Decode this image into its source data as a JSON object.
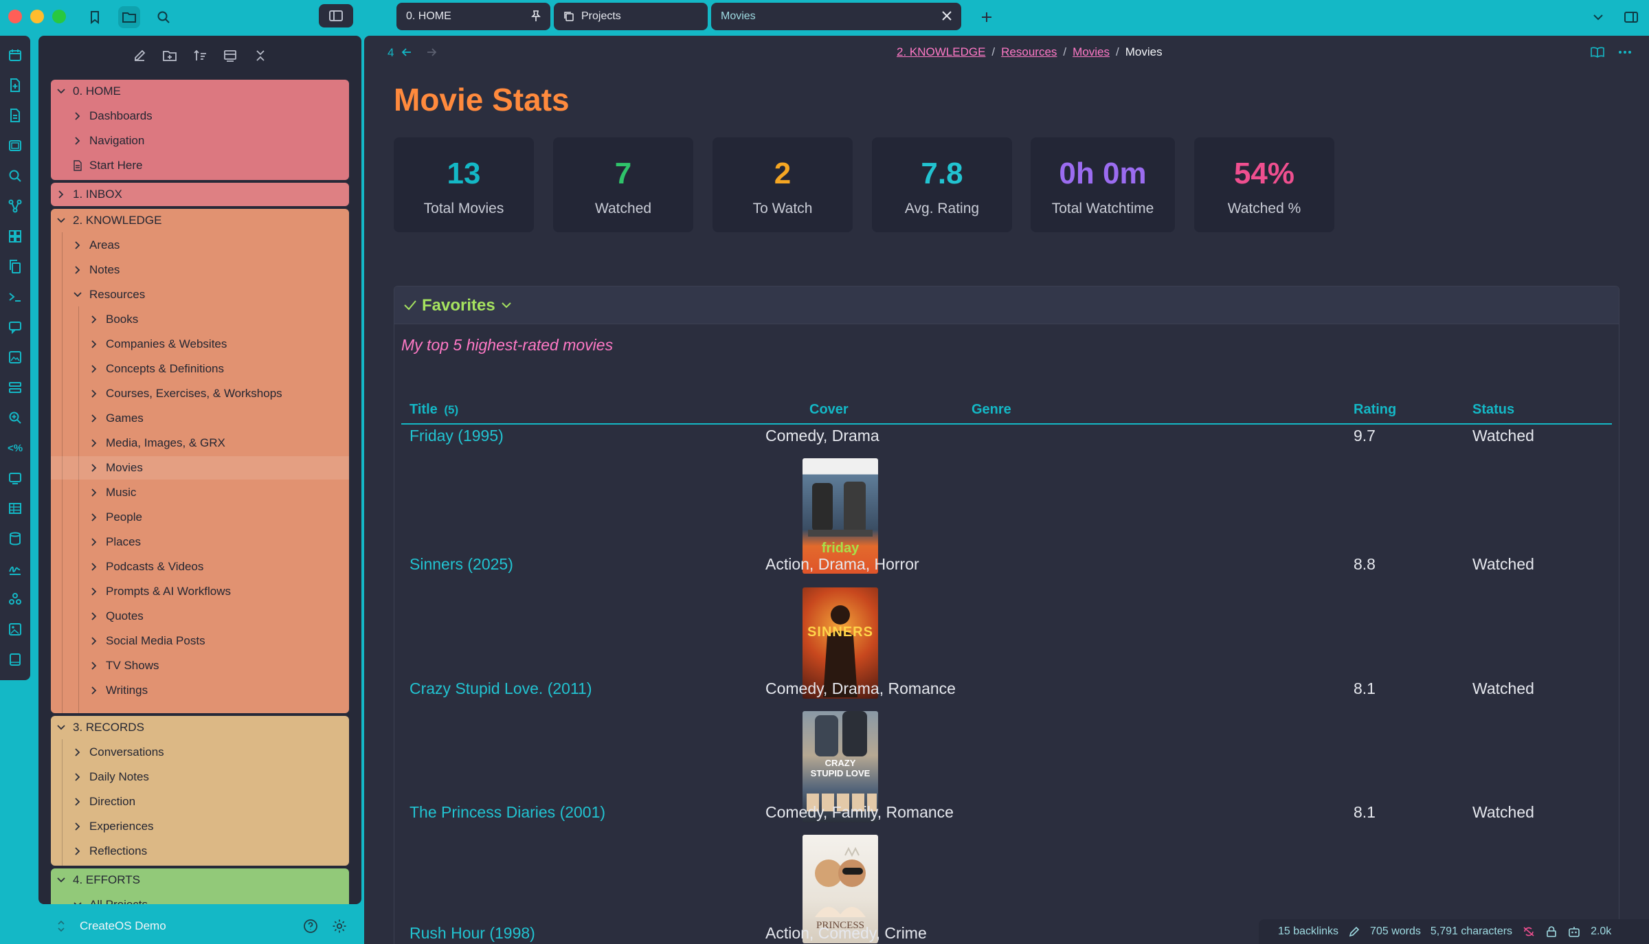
{
  "colors": {
    "accent": "#14b8c6",
    "home_group": "#dc7880",
    "inbox_group": "#de8083",
    "knowledge_group": "#e19271",
    "records_group": "#dcb885",
    "efforts_group": "#92c979",
    "title_orange": "#ff8a3d",
    "pink": "#ff79c6"
  },
  "tabs": [
    {
      "label": "0. HOME",
      "icon": "pin-icon"
    },
    {
      "label": "Projects",
      "icon": "copy-icon"
    },
    {
      "label": "Movies",
      "icon": "close-icon"
    }
  ],
  "nav": {
    "back_count": "4",
    "breadcrumb": [
      "2. KNOWLEDGE",
      "Resources",
      "Movies"
    ],
    "current": "Movies"
  },
  "tree": {
    "home": {
      "label": "0. HOME",
      "items": [
        "Dashboards",
        "Navigation"
      ],
      "file": "Start Here"
    },
    "inbox": {
      "label": "1. INBOX"
    },
    "knowledge": {
      "label": "2. KNOWLEDGE",
      "items": [
        "Areas",
        "Notes"
      ],
      "resources": "Resources",
      "resource_items": [
        "Books",
        "Companies & Websites",
        "Concepts & Definitions",
        "Courses, Exercises, & Workshops",
        "Games",
        "Media, Images, & GRX",
        "Movies",
        "Music",
        "People",
        "Places",
        "Podcasts & Videos",
        "Prompts & AI Workflows",
        "Quotes",
        "Social Media Posts",
        "TV Shows",
        "Writings"
      ]
    },
    "records": {
      "label": "3. RECORDS",
      "items": [
        "Conversations",
        "Daily Notes",
        "Direction",
        "Experiences",
        "Reflections"
      ]
    },
    "efforts": {
      "label": "4. EFFORTS",
      "items": [
        "All Projects"
      ]
    }
  },
  "vault": {
    "name": "CreateOS Demo"
  },
  "page": {
    "title": "Movie Stats",
    "stats": [
      {
        "value": "13",
        "label": "Total Movies",
        "color": "#14b8c6"
      },
      {
        "value": "7",
        "label": "Watched",
        "color": "#2fc36a"
      },
      {
        "value": "2",
        "label": "To Watch",
        "color": "#f5a623"
      },
      {
        "value": "7.8",
        "label": "Avg. Rating",
        "color": "#22c3d1"
      },
      {
        "value": "0h 0m",
        "label": "Total Watchtime",
        "color": "#9b6cf0"
      },
      {
        "value": "54%",
        "label": "Watched %",
        "color": "#ef4f8f"
      }
    ],
    "favorites": {
      "heading": "Favorites",
      "description": "My top 5 highest-rated movies",
      "columns": {
        "title": "Title",
        "count": "(5)",
        "cover": "Cover",
        "genre": "Genre",
        "rating": "Rating",
        "status": "Status"
      },
      "rows": [
        {
          "title": "Friday (1995)",
          "cover_text": "friday",
          "genre": "Comedy, Drama",
          "rating": "9.7",
          "status": "Watched"
        },
        {
          "title": "Sinners (2025)",
          "cover_text": "SINNERS",
          "genre": "Action, Drama, Horror",
          "rating": "8.8",
          "status": "Watched"
        },
        {
          "title": "Crazy Stupid Love. (2011)",
          "cover_text": "CRAZY STUPID LOVE",
          "genre": "Comedy, Drama, Romance",
          "rating": "8.1",
          "status": "Watched"
        },
        {
          "title": "The Princess Diaries (2001)",
          "cover_text": "PRINCESS",
          "genre": "Comedy, Family, Romance",
          "rating": "8.1",
          "status": "Watched"
        },
        {
          "title": "Rush Hour (1998)",
          "cover_text": "",
          "genre": "Action, Comedy, Crime",
          "rating": "",
          "status": ""
        }
      ]
    }
  },
  "status": {
    "backlinks": "15 backlinks",
    "words": "705 words",
    "characters": "5,791 characters",
    "extra": "2.0k"
  }
}
